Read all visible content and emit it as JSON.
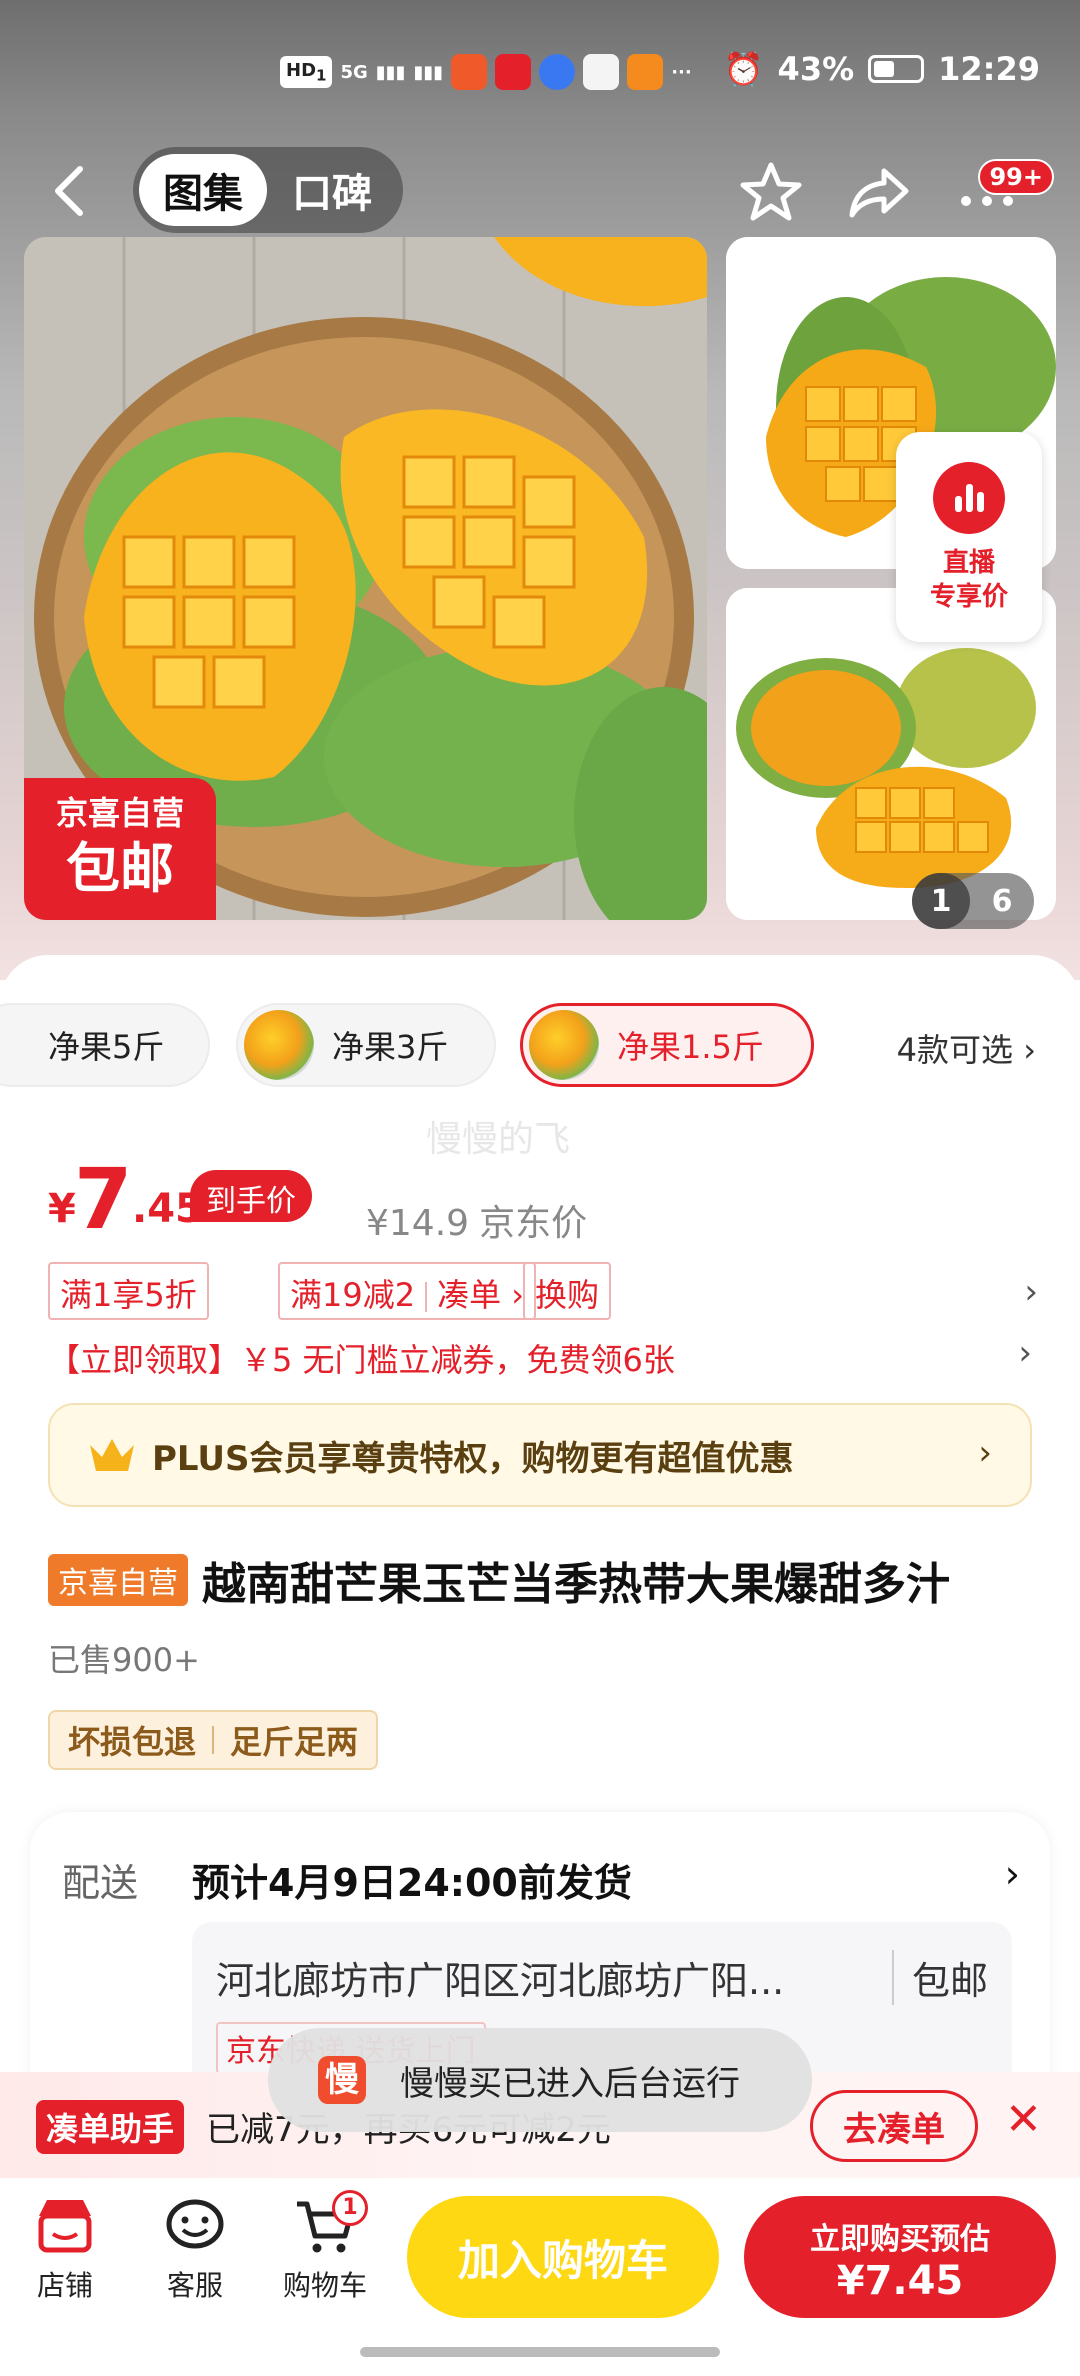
{
  "status_bar": {
    "hd": "HD",
    "hd_sub": "1",
    "net": "5G",
    "battery_pct": "43%",
    "time": "12:29",
    "more": "···"
  },
  "nav": {
    "tabs": [
      "图集",
      "口碑"
    ],
    "active_tab": 0,
    "cart_badge": "99+"
  },
  "gallery": {
    "tag_line1": "京喜自营",
    "tag_line2": "包邮",
    "live_line1": "直播",
    "live_line2": "专享价",
    "page_current": "1",
    "page_total": "6"
  },
  "variants": {
    "items": [
      "净果5斤",
      "净果3斤",
      "净果1.5斤"
    ],
    "selected": 2,
    "more_label": "4款可选"
  },
  "watermark": "慢慢的飞",
  "price": {
    "currency": "¥",
    "integer": "7",
    "decimal": ".45",
    "final_label": "到手价",
    "jd_price": "¥14.9",
    "jd_label": "京东价"
  },
  "promos": {
    "p1": "满1享5折",
    "p2": "满19减2",
    "p2_link": "凑单 ›",
    "p3": "换购"
  },
  "coupon": "【立即领取】￥5 无门槛立减券，免费领6张",
  "plus": {
    "text": "PLUS会员享尊贵特权，购物更有超值优惠"
  },
  "product": {
    "store_tag": "京喜自营",
    "title": "越南甜芒果玉芒当季热带大果爆甜多汁",
    "sold": "已售900+",
    "guarantees": [
      "坏损包退",
      "足斤足两"
    ]
  },
  "delivery": {
    "label": "配送",
    "eta": "预计4月9日24:00前发货",
    "address": "河北廊坊市广阳区河北廊坊广阳...",
    "shipping": "包邮",
    "express": "京东快递 送货上门"
  },
  "helper": {
    "tag": "凑单助手",
    "text": "已减7元，再买6元可减2元",
    "button": "去凑单",
    "close": "✕"
  },
  "toast": {
    "icon": "慢",
    "text": "慢慢买已进入后台运行"
  },
  "bottom": {
    "store": "店铺",
    "service": "客服",
    "cart": "购物车",
    "cart_count": "1",
    "add_to_cart": "加入购物车",
    "buy_line1": "立即购买预估",
    "buy_line2": "¥7.45"
  }
}
